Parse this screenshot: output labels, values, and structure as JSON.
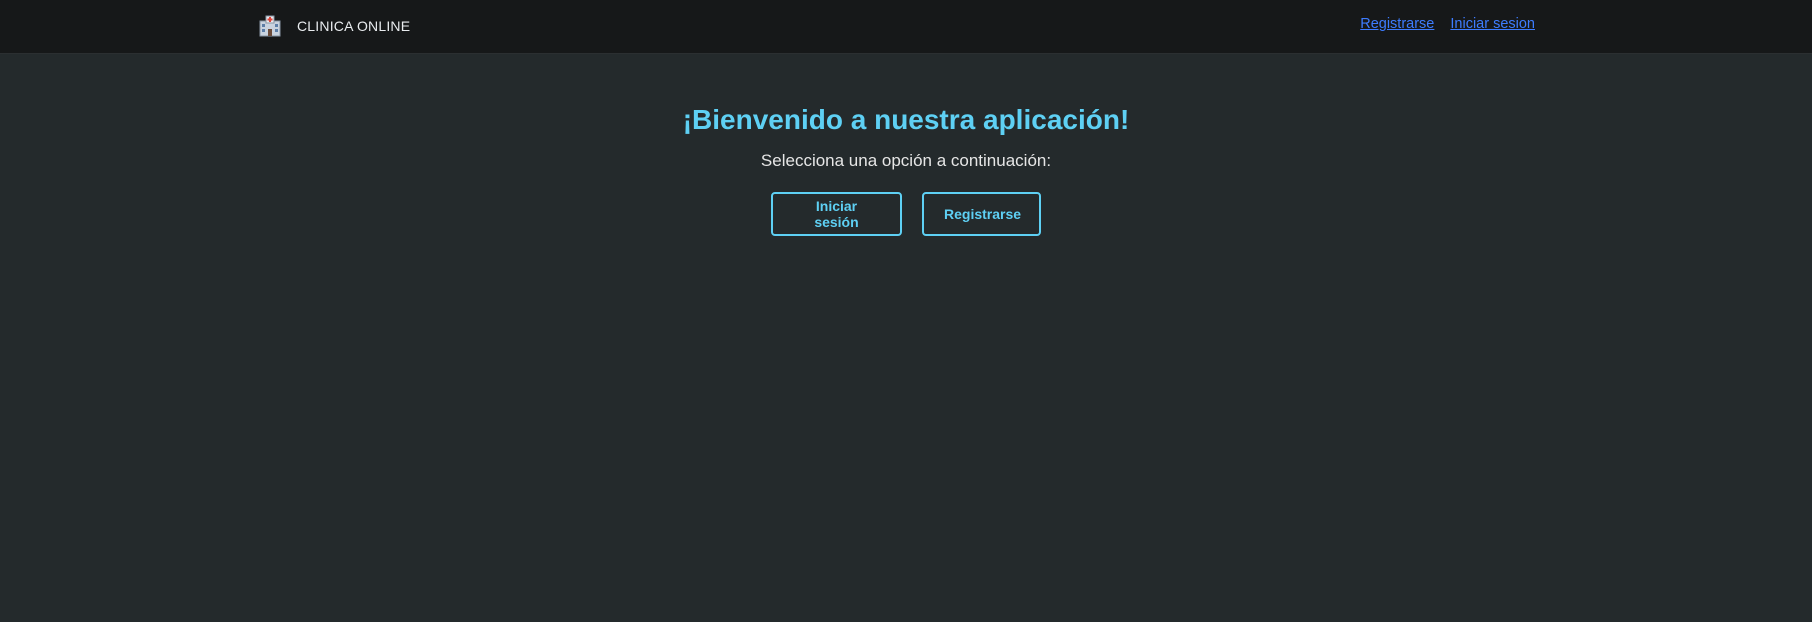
{
  "navbar": {
    "brand_icon": "hospital-icon",
    "brand_name": "CLINICA ONLINE",
    "links": [
      {
        "label": "Registrarse"
      },
      {
        "label": "Iniciar sesion"
      }
    ]
  },
  "hero": {
    "title": "¡Bienvenido a nuestra aplicación!",
    "subtitle": "Selecciona una opción a continuación:",
    "buttons": {
      "login": "Iniciar sesión",
      "register": "Registrarse"
    }
  },
  "colors": {
    "background": "#242a2c",
    "navbar": "#161819",
    "accent": "#5ed0f4",
    "link": "#3d7cff"
  }
}
